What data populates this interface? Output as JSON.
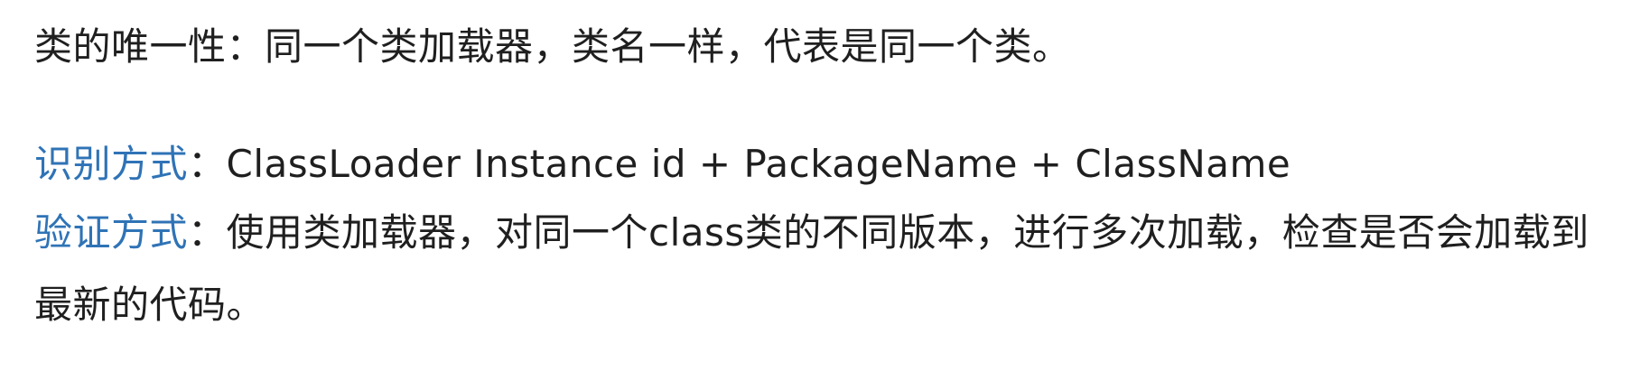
{
  "doc": {
    "uniqueness": "类的唯一性：同一个类加载器，类名一样，代表是同一个类。",
    "identify": {
      "term": "识别方式",
      "colon": "：",
      "text": "ClassLoader Instance id + PackageName + ClassName"
    },
    "verify": {
      "term": "验证方式",
      "colon": "：",
      "text": "使用类加载器，对同一个class类的不同版本，进行多次加载，检查是否会加载到最新的代码。"
    },
    "colors": {
      "term": "#2f73b6",
      "text": "#1f1f1f"
    }
  }
}
